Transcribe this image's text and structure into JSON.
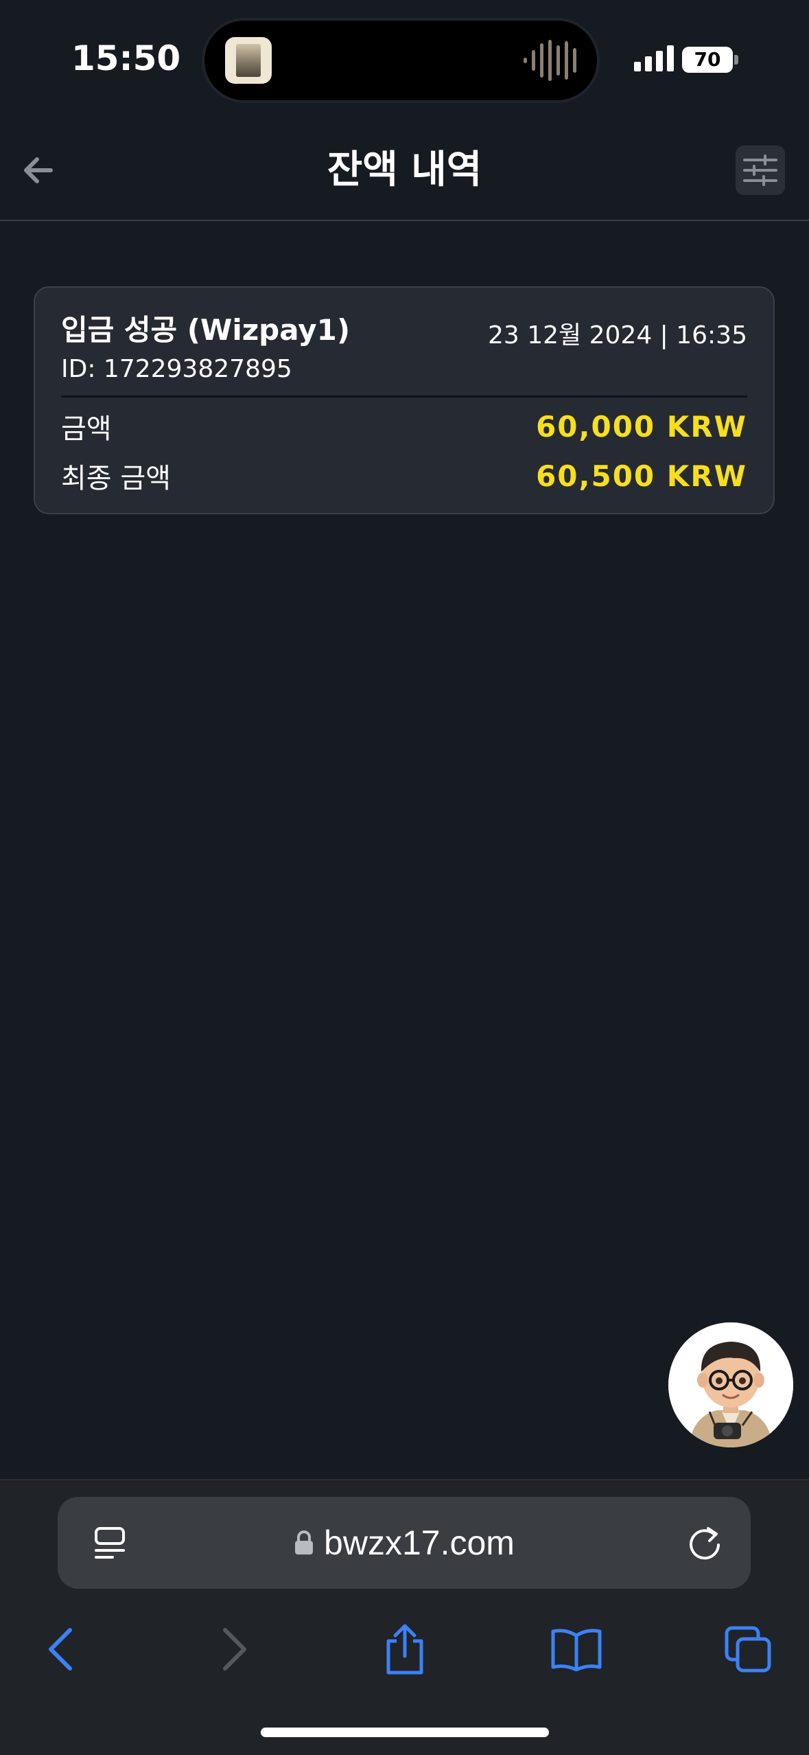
{
  "status_bar": {
    "time": "15:50",
    "battery": "70"
  },
  "header": {
    "title": "잔액 내역",
    "back_icon": "arrow-left-icon",
    "filter_icon": "sliders-icon"
  },
  "transaction": {
    "title": "입금 성공 (Wizpay1)",
    "date": "23 12월 2024 | 16:35",
    "id": "ID: 172293827895",
    "amount_label": "금액",
    "amount_value": "60,000 KRW",
    "final_label": "최종 금액",
    "final_value": "60,500 KRW",
    "amount_color": "#f7df1e"
  },
  "browser": {
    "url": "bwzx17.com",
    "icons": [
      "reader-icon",
      "lock-icon",
      "reload-icon",
      "back-chevron-icon",
      "forward-chevron-icon",
      "share-icon",
      "bookmarks-icon",
      "tabs-icon"
    ],
    "accent": "#3b82f6"
  }
}
